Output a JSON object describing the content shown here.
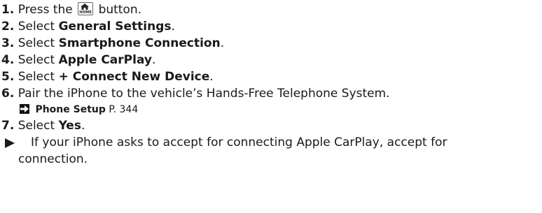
{
  "steps": [
    {
      "num": "1.",
      "pre": "Press the",
      "icon_label": "HOME",
      "post": "button."
    },
    {
      "num": "2.",
      "pre": "Select",
      "bold": "General Settings",
      "post": "."
    },
    {
      "num": "3.",
      "pre": "Select",
      "bold": "Smartphone Connection",
      "post": "."
    },
    {
      "num": "4.",
      "pre": "Select",
      "bold": "Apple CarPlay",
      "post": "."
    },
    {
      "num": "5.",
      "pre": "Select",
      "bold": "+ Connect New Device",
      "post": "."
    },
    {
      "num": "6.",
      "text": "Pair the iPhone to the vehicle’s Hands-Free Telephone System."
    },
    {
      "num": "7.",
      "pre": "Select",
      "bold": "Yes",
      "post": "."
    }
  ],
  "reference": {
    "title": "Phone Setup",
    "page": "P. 344"
  },
  "note": {
    "line1": "If your iPhone asks to accept for connecting Apple CarPlay, accept for",
    "line2": "connection."
  },
  "icons": {
    "home": "home-icon",
    "ref": "cross-reference-arrow-icon",
    "note": "triangle-bullet-icon"
  }
}
